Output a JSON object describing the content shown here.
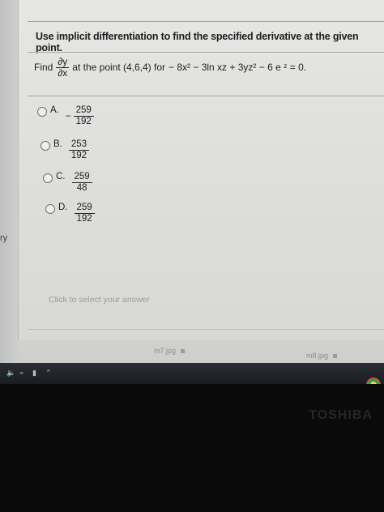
{
  "question": {
    "prompt": "Use implicit differentiation to find the specified derivative at the given point.",
    "find_label": "Find",
    "deriv_num": "∂y",
    "deriv_den": "∂x",
    "at_point": "at the point (4,6,4) for",
    "equation": "− 8x² − 3ln xz + 3yz² − 6 e ᶻ = 0."
  },
  "options": [
    {
      "letter": "A.",
      "negative": "−",
      "numerator": "259",
      "denominator": "192"
    },
    {
      "letter": "B.",
      "negative": "",
      "numerator": "253",
      "denominator": "192"
    },
    {
      "letter": "C.",
      "negative": "",
      "numerator": "259",
      "denominator": "48"
    },
    {
      "letter": "D.",
      "negative": "",
      "numerator": "259",
      "denominator": "192"
    }
  ],
  "hint": "Click to select your answer",
  "side_text": "ry",
  "downloads": [
    "m7.jpg",
    "m8.jpg"
  ],
  "brand": "TOSHIBA"
}
